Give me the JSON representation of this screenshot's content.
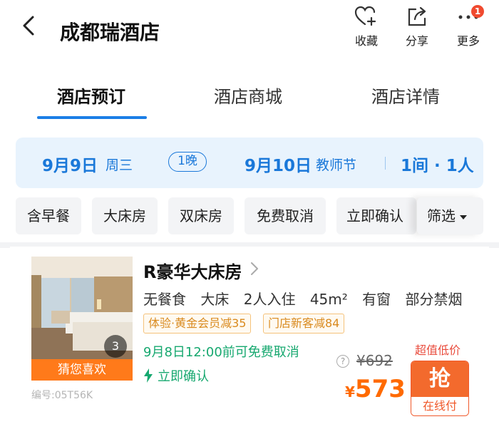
{
  "header": {
    "title": "成都瑞酒店"
  },
  "actions": [
    {
      "label": "收藏",
      "icon": "heart-plus-icon"
    },
    {
      "label": "分享",
      "icon": "share-icon"
    },
    {
      "label": "更多",
      "icon": "more-icon",
      "badge": "1"
    }
  ],
  "tabs": [
    "酒店预订",
    "酒店商城",
    "酒店详情"
  ],
  "dates": {
    "checkin": "9月9日",
    "checkin_day": "周三",
    "nights": "1晚",
    "checkout": "9月10日",
    "checkout_day": "教师节",
    "rooms_guests": "1间 · 1人"
  },
  "filters": [
    "含早餐",
    "大床房",
    "双床房",
    "免费取消",
    "立即确认",
    "筛选"
  ],
  "room": {
    "name": "R豪华大床房",
    "facts": [
      "无餐食",
      "大床",
      "2人入住",
      "45m²",
      "有窗",
      "部分禁烟"
    ],
    "tags": [
      "体验·黄金会员减35",
      "门店新客减84"
    ],
    "cancel": "9月8日12:00前可免费取消",
    "confirm": "立即确认",
    "photo_count": "3",
    "guess_label": "猜您喜欢",
    "code": "编号:05T56K",
    "old_price": "¥692",
    "currency": "¥",
    "price": "573",
    "deal_label": "超值低价",
    "grab_label": "抢",
    "grab_sub": "在线付"
  },
  "colors": {
    "accent": "#1a78d9",
    "price": "#ff6a00",
    "green": "#16a86f",
    "tag": "#d98a1e"
  }
}
